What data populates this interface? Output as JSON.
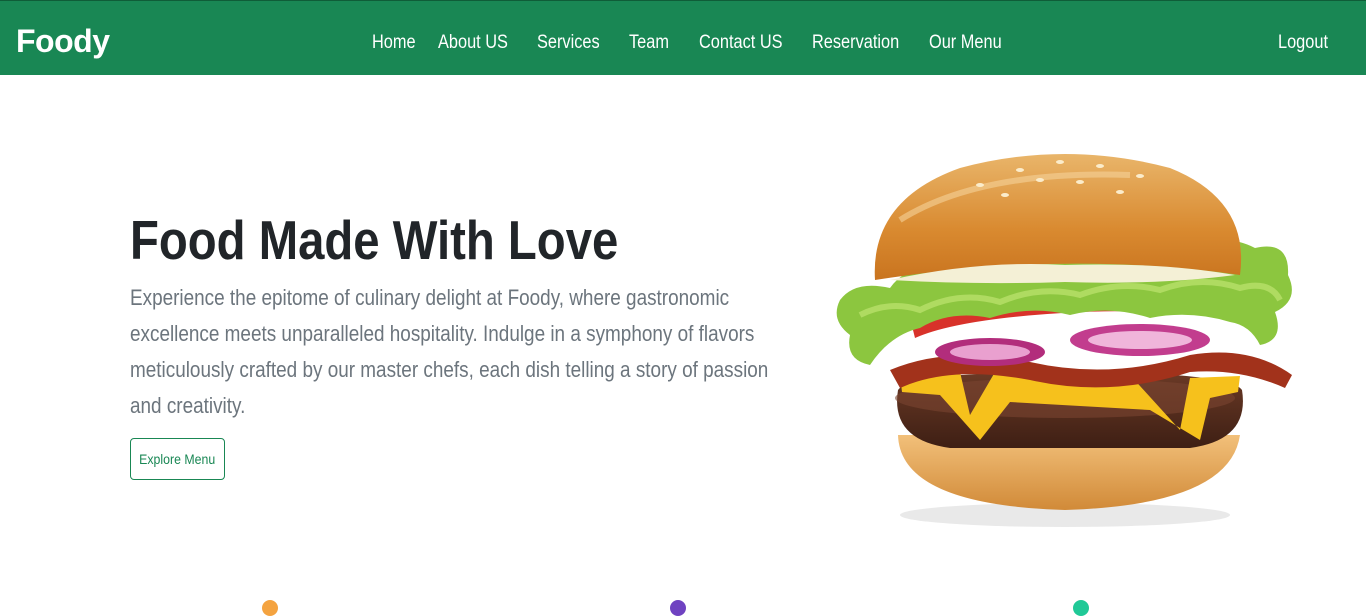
{
  "navbar": {
    "brand": "Foody",
    "links": [
      "Home",
      "About US",
      "Services",
      "Team",
      "Contact US",
      "Reservation",
      "Our Menu"
    ],
    "logout": "Logout",
    "color": "#198754"
  },
  "hero": {
    "title": "Food Made With Love",
    "description": "Experience the epitome of culinary delight at Foody, where gastronomic excellence meets unparalleled hospitality. Indulge in a symphony of flavors meticulously crafted by our master chefs, each dish telling a story of passion and creativity.",
    "button_label": "Explore Menu",
    "image": "burger-image"
  }
}
